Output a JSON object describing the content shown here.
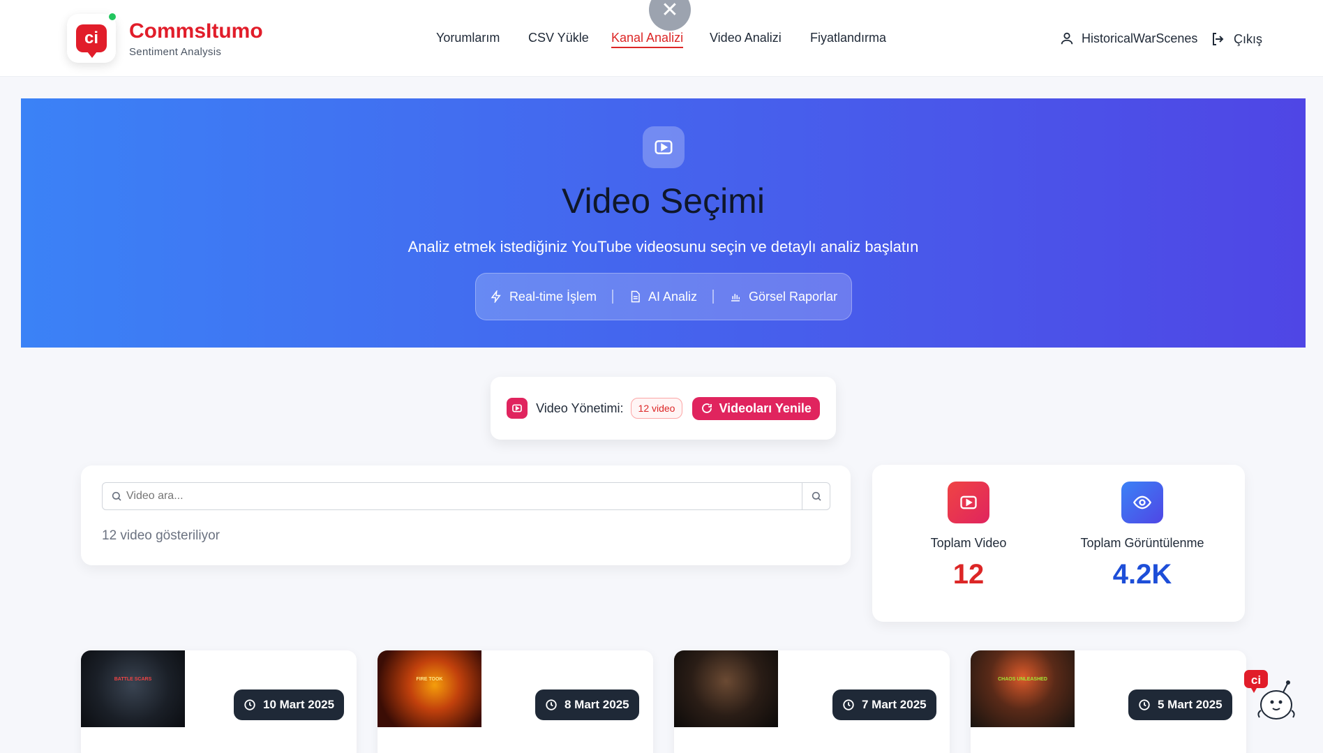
{
  "brand": {
    "logo_text": "ci",
    "name": "CommsItumo",
    "subtitle": "Sentiment Analysis",
    "accent": "#e11d2a"
  },
  "nav": {
    "items": [
      {
        "label": "Yorumlarım",
        "active": false
      },
      {
        "label": "CSV Yükle",
        "active": false
      },
      {
        "label": "Kanal Analizi",
        "active": true
      },
      {
        "label": "Video Analizi",
        "active": false
      },
      {
        "label": "Fiyatlandırma",
        "active": false
      }
    ],
    "close_icon": "close-icon"
  },
  "user": {
    "name": "HistoricalWarScenes",
    "logout_label": "Çıkış"
  },
  "hero": {
    "title": "Video Seçimi",
    "subtitle": "Analiz etmek istediğiniz YouTube videosunu seçin ve detaylı analiz başlatın",
    "features": [
      "Real-time İşlem",
      "AI Analiz",
      "Görsel Raporlar"
    ],
    "gradient": [
      "#3b82f6",
      "#4f46e5"
    ]
  },
  "management": {
    "label": "Video Yönetimi:",
    "count_badge": "12 video",
    "refresh_label": "Videoları Yenile",
    "color": "#e0245e"
  },
  "search": {
    "placeholder": "Video ara...",
    "result_text": "12 video gösteriliyor"
  },
  "stats": [
    {
      "label": "Toplam Video",
      "value": "12",
      "color": "#dc2626",
      "icon": "youtube-icon"
    },
    {
      "label": "Toplam Görüntülenme",
      "value": "4.2K",
      "color": "#1d4ed8",
      "icon": "eye-icon"
    }
  ],
  "videos": [
    {
      "date": "10 Mart 2025",
      "thumb_text": "BATTLE SCARS"
    },
    {
      "date": "8 Mart 2025",
      "thumb_text": "FIRE TOOK"
    },
    {
      "date": "7 Mart 2025",
      "thumb_text": ""
    },
    {
      "date": "5 Mart 2025",
      "thumb_text": "CHAOS UNLEASHED"
    }
  ],
  "mascot_logo_text": "ci"
}
